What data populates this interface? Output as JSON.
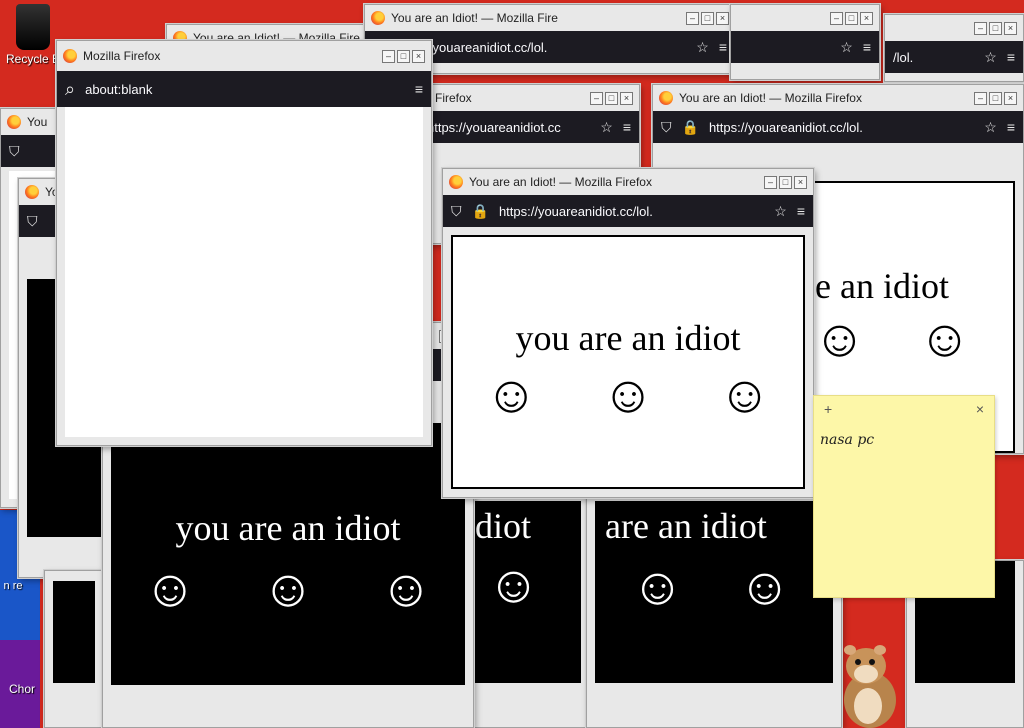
{
  "desktop": {
    "icons": [
      {
        "label": "Recycle B"
      },
      {
        "label": "Chor"
      },
      {
        "label": "n re"
      }
    ]
  },
  "windows": {
    "blank": {
      "title": "Mozilla Firefox",
      "url": "about:blank"
    },
    "idiot_title": "You are an Idiot! — Mozilla Firefox",
    "idiot_title_short": "You are an Idiot! — Mozilla Fire",
    "title_you": "You",
    "title_yo": "Yo",
    "title_ffx": "a Firefox",
    "url_full": "https://youareanidiot.cc/lol.",
    "url_mid": "https://youareanidiot.cc",
    "url_short": "/lol.",
    "page_text": "you are an idiot",
    "page_text_right": "e an idiot",
    "page_text_partial": "diot",
    "page_text_are": "are an idiot"
  },
  "sticky_note": {
    "add": "+",
    "close": "×",
    "text": "nasa pc"
  },
  "glyphs": {
    "smile": "☺",
    "menu": "≡",
    "shield": "⛉",
    "lock": "🔒",
    "star": "☆",
    "search": "⌕",
    "min": "–",
    "max": "□",
    "close": "×"
  }
}
